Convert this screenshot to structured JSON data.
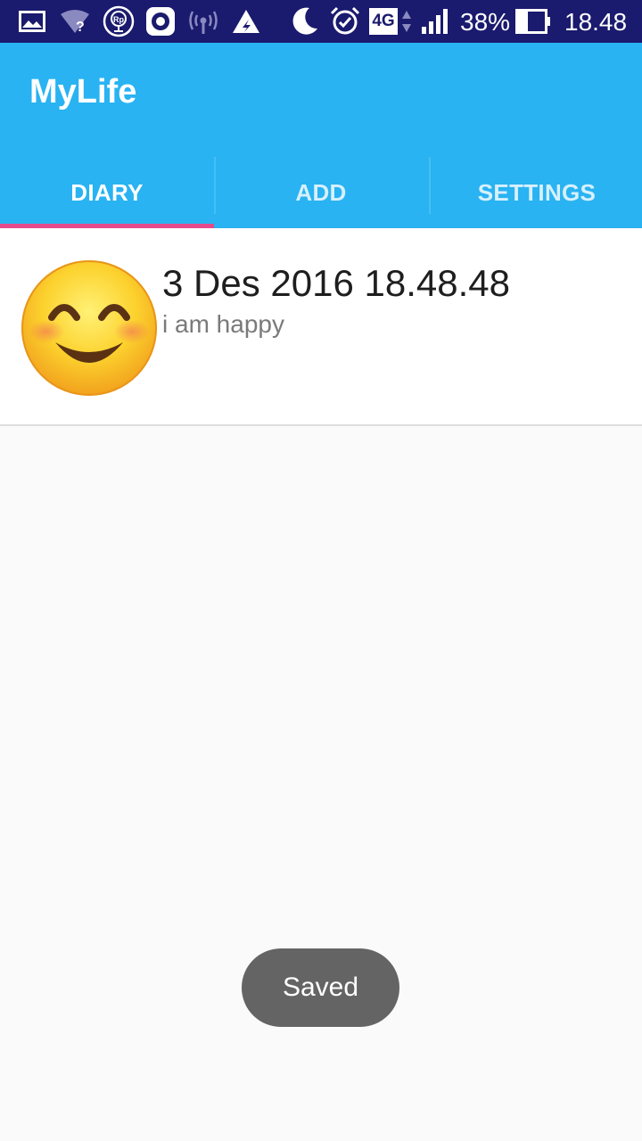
{
  "status_bar": {
    "icons": [
      "gallery-icon",
      "wifi-question-icon",
      "rp-icon",
      "record-icon",
      "hotspot-icon",
      "vpn-icon",
      "moon-icon",
      "alarm-icon",
      "4g-icon",
      "signal-icon",
      "battery-icon"
    ],
    "network_label": "4G",
    "battery_text": "38%",
    "time": "18.48",
    "colors": {
      "background": "#1a1a6e"
    }
  },
  "app_bar": {
    "title": "MyLife",
    "color": "#29b3f2"
  },
  "tabs": [
    {
      "label": "DIARY",
      "selected": true
    },
    {
      "label": "ADD",
      "selected": false
    },
    {
      "label": "SETTINGS",
      "selected": false
    }
  ],
  "tab_indicator_color": "#e54a8c",
  "diary_entries": [
    {
      "mood_icon": "smiling-face-icon",
      "date": "3 Des 2016 18.48.48",
      "note": "i am happy"
    }
  ],
  "toast": {
    "text": "Saved"
  }
}
